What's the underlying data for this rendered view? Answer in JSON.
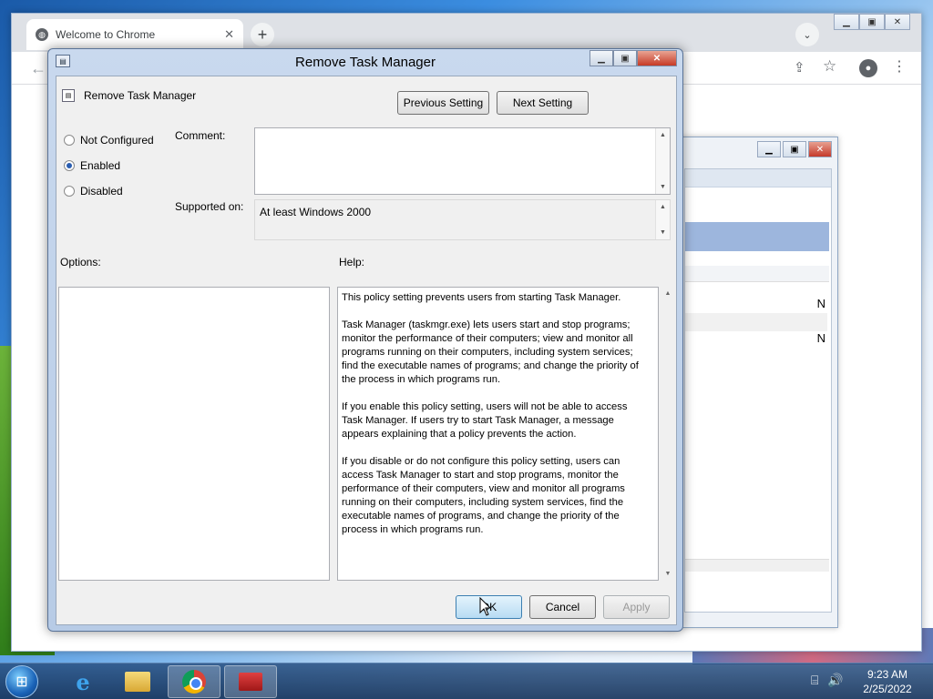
{
  "chrome": {
    "tab_title": "Welcome to Chrome",
    "tab_close": "✕",
    "new_tab": "+",
    "tab_search": "⌄"
  },
  "dialog": {
    "title": "Remove Task Manager",
    "policy_name": "Remove Task Manager",
    "prev_button": "Previous Setting",
    "next_button": "Next Setting",
    "options": [
      {
        "label": "Not Configured",
        "selected": false
      },
      {
        "label": "Enabled",
        "selected": true
      },
      {
        "label": "Disabled",
        "selected": false
      }
    ],
    "comment_label": "Comment:",
    "comment_value": "",
    "supported_label": "Supported on:",
    "supported_value": "At least Windows 2000",
    "options_label": "Options:",
    "help_label": "Help:",
    "help": [
      "This policy setting prevents users from starting Task Manager.",
      "Task Manager (taskmgr.exe) lets users start and stop programs; monitor the performance of their computers; view and monitor all programs running on their computers, including system services; find the executable names of programs; and change the priority of the process in which programs run.",
      "If you enable this policy setting, users will not be able to access Task Manager. If users try to start Task Manager, a message appears explaining that a policy prevents the action.",
      "If you disable or do not configure this policy setting, users can access Task Manager to  start and stop programs, monitor the performance of their computers, view and monitor all programs running on their computers, including system services, find the executable names of programs, and change the priority of the process in which programs run."
    ],
    "ok_button": "OK",
    "cancel_button": "Cancel",
    "apply_button": "Apply"
  },
  "background_window": {
    "row_values": [
      "N",
      "N"
    ]
  },
  "taskbar": {
    "time": "9:23 AM",
    "date": "2/25/2022"
  },
  "colors": {
    "dialog_frame": "#b7cbe6",
    "selected_row": "#9db6dd",
    "taskbar": "#1f4a80"
  }
}
